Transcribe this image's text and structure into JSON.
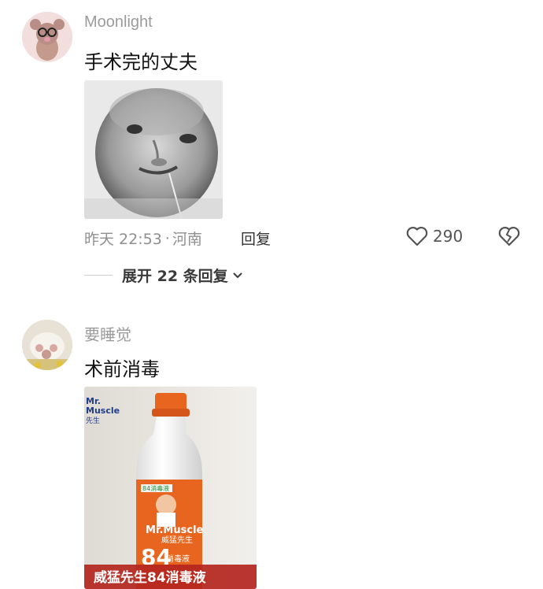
{
  "comments": [
    {
      "username": "Moonlight",
      "text": "手术完的丈夫",
      "time": "昨天 22:53",
      "location": "河南",
      "reply_label": "回复",
      "likes": "290",
      "expand_label": "展开 22 条回复"
    },
    {
      "username": "要睡觉",
      "text": "术前消毒",
      "product_logo_line1": "Mr.",
      "product_logo_line2": "Muscle",
      "product_logo_cn": "先生",
      "bottle_label_top": "84消毒液",
      "bottle_brand": "Mr.Muscle",
      "bottle_brand_cn": "威猛先生",
      "bottle_number": "84",
      "bottle_disinfect": "消毒液",
      "caption": "威猛先生84消毒液"
    }
  ],
  "meta_separator": "·",
  "colors": {
    "meta": "#8f8f8f",
    "username": "#9b9b9b",
    "bottle_orange": "#e8651f"
  }
}
